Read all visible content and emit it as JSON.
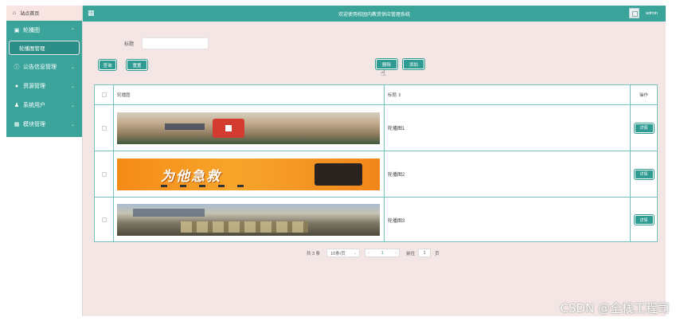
{
  "sidebar": {
    "home_label": "站点首页",
    "items": [
      {
        "label": "轮播图",
        "icon": "image-icon",
        "expanded": true
      },
      {
        "label": "公告信息管理",
        "icon": "info-circle-icon"
      },
      {
        "label": "资源管理",
        "icon": "pin-icon"
      },
      {
        "label": "系统用户",
        "icon": "user-icon"
      },
      {
        "label": "模块管理",
        "icon": "grid-icon"
      }
    ],
    "sub_item": "轮播图管理"
  },
  "topbar": {
    "title": "欢迎使用校园内教资供应管理系统",
    "user": "admin"
  },
  "filter": {
    "label": "标题",
    "value": ""
  },
  "buttons": {
    "query": "查询",
    "reset": "重置",
    "delete": "删除",
    "add": "添加"
  },
  "table": {
    "headers": [
      "轮播图",
      "标题 ⇕",
      "操作"
    ],
    "rows": [
      {
        "title": "轮播图1",
        "action": "详情"
      },
      {
        "title": "轮播图2",
        "action": "详情"
      },
      {
        "title": "轮播图3",
        "action": "详情"
      }
    ],
    "banner2_text": "为他急救"
  },
  "pagination": {
    "total": "共 3 条",
    "page_size": "10条/页",
    "current": "1",
    "goto_label": "前往",
    "goto_value": "1",
    "unit": "页"
  },
  "watermark": "CSDN @全栈工程司",
  "colors": {
    "accent": "#3aa39a",
    "background": "#f3e6e4",
    "border": "#74c3bd"
  }
}
